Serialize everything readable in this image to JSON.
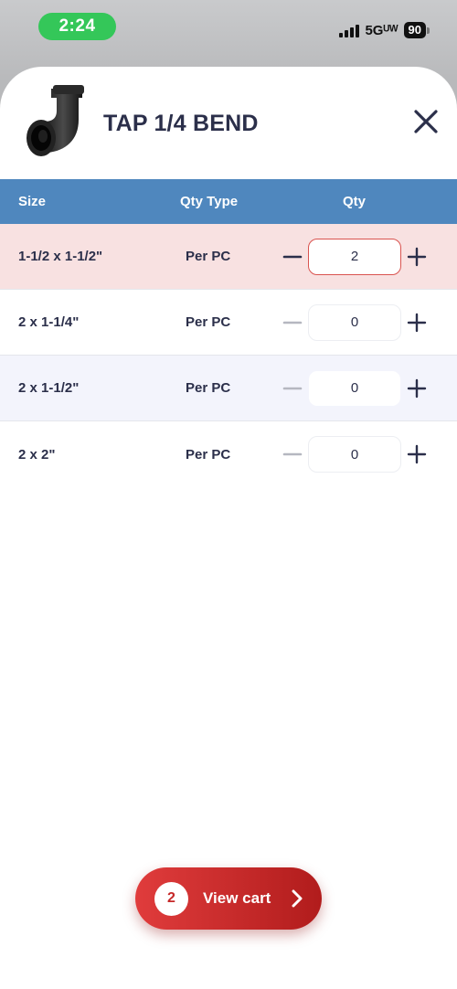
{
  "status_bar": {
    "time": "2:24",
    "network": "5Gᵁᵂ",
    "battery": "90"
  },
  "product": {
    "title": "TAP 1/4 BEND",
    "image_icon": "pipe-elbow-icon"
  },
  "table": {
    "headers": {
      "size": "Size",
      "qty_type": "Qty Type",
      "qty": "Qty"
    },
    "rows": [
      {
        "size": "1-1/2 x 1-1/2\"",
        "qty_type": "Per PC",
        "qty": "2"
      },
      {
        "size": "2 x 1-1/4\"",
        "qty_type": "Per PC",
        "qty": "0"
      },
      {
        "size": "2 x 1-1/2\"",
        "qty_type": "Per PC",
        "qty": "0"
      },
      {
        "size": "2 x 2\"",
        "qty_type": "Per PC",
        "qty": "0"
      }
    ]
  },
  "cart": {
    "count": "2",
    "label": "View cart"
  },
  "colors": {
    "header_blue": "#4f87be",
    "active_row": "#f8e1e1",
    "alt_row": "#f3f4fc",
    "cart_red": "#d32f2f",
    "status_green": "#34c759",
    "text_dark": "#2b2f4a"
  }
}
